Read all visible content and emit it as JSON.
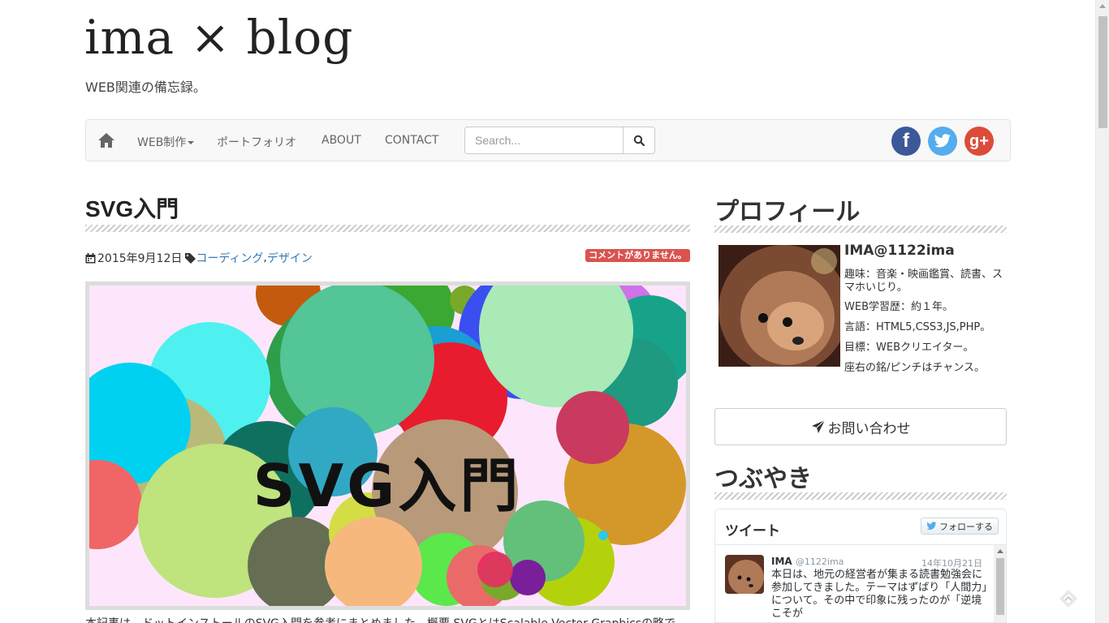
{
  "site": {
    "title": "ima × blog",
    "description": "WEB関連の備忘録。"
  },
  "nav": {
    "items": [
      {
        "label": "WEB制作"
      },
      {
        "label": "ポートフォリオ"
      },
      {
        "label": "ABOUT"
      },
      {
        "label": "CONTACT"
      }
    ],
    "search_placeholder": "Search...",
    "social": {
      "facebook": "f",
      "googleplus": "g+"
    }
  },
  "post": {
    "title": "SVG入門",
    "date": "2015年9月12日",
    "categories": [
      "コーディング",
      "デザイン"
    ],
    "category_sep": ",",
    "comment_badge": "コメントがありません。",
    "image_caption": "SVG入門",
    "intro": "本記事は、ドットインストールのSVG入門を参考にまとめました。概要 SVGとはScalable Vector Graphicsの略で"
  },
  "sidebar": {
    "profile_heading": "プロフィール",
    "profile_name": "IMA@1122ima",
    "profile_lines": [
      "趣味：音楽・映画鑑賞、読書、スマホいじり。",
      "WEB学習歴：約１年。",
      "言語：HTML5,CSS3,JS,PHP。",
      "目標：WEBクリエイター。",
      "座右の銘/ピンチはチャンス。"
    ],
    "contact_label": "お問い合わせ",
    "tweets_heading": "つぶやき",
    "twitter": {
      "header": "ツイート",
      "follow_label": "フォローする",
      "tweet_name": "IMA",
      "tweet_handle": "@1122ima",
      "tweet_date": "14年10月21日",
      "tweet_text": "本日は、地元の経営者が集まる読書勉強会に参加してきました。テーマはずばり「人間力」について。その中で印象に残ったのが「逆境こそが"
    }
  },
  "colors": {
    "link": "#337ab7",
    "badge": "#d9534f",
    "facebook": "#3b5998",
    "twitter": "#55acee",
    "googleplus": "#dd4b39"
  }
}
